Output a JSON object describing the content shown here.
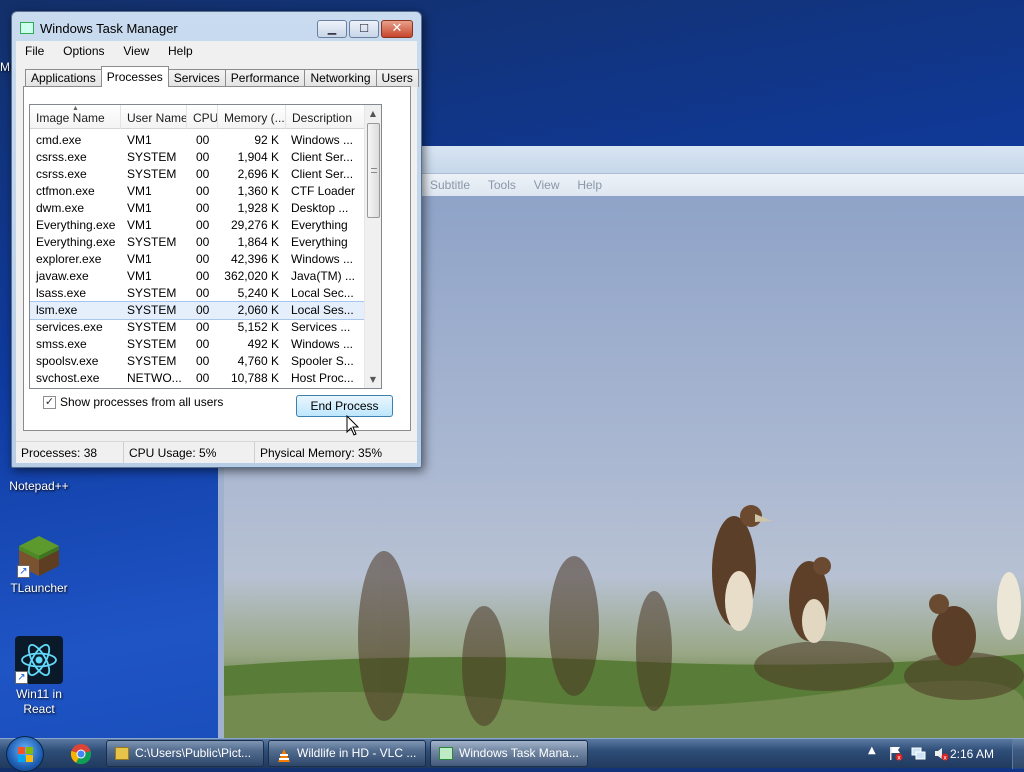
{
  "desktop": {
    "icons": [
      {
        "label": "Notepad++"
      },
      {
        "label": "TLauncher"
      },
      {
        "label": "Win11 in React"
      }
    ],
    "partial_icon_label": "M"
  },
  "vlc_window": {
    "menu": [
      "Subtitle",
      "Tools",
      "View",
      "Help"
    ]
  },
  "task_manager": {
    "title": "Windows Task Manager",
    "menu": [
      "File",
      "Options",
      "View",
      "Help"
    ],
    "tabs": [
      "Applications",
      "Processes",
      "Services",
      "Performance",
      "Networking",
      "Users"
    ],
    "active_tab": "Processes",
    "columns": [
      "Image Name",
      "User Name",
      "CPU",
      "Memory (...",
      "Description"
    ],
    "processes": [
      {
        "name": "cmd.exe",
        "user": "VM1",
        "cpu": "00",
        "mem": "92 K",
        "desc": "Windows ..."
      },
      {
        "name": "csrss.exe",
        "user": "SYSTEM",
        "cpu": "00",
        "mem": "1,904 K",
        "desc": "Client Ser..."
      },
      {
        "name": "csrss.exe",
        "user": "SYSTEM",
        "cpu": "00",
        "mem": "2,696 K",
        "desc": "Client Ser..."
      },
      {
        "name": "ctfmon.exe",
        "user": "VM1",
        "cpu": "00",
        "mem": "1,360 K",
        "desc": "CTF Loader"
      },
      {
        "name": "dwm.exe",
        "user": "VM1",
        "cpu": "00",
        "mem": "1,928 K",
        "desc": "Desktop ..."
      },
      {
        "name": "Everything.exe",
        "user": "VM1",
        "cpu": "00",
        "mem": "29,276 K",
        "desc": "Everything"
      },
      {
        "name": "Everything.exe",
        "user": "SYSTEM",
        "cpu": "00",
        "mem": "1,864 K",
        "desc": "Everything"
      },
      {
        "name": "explorer.exe",
        "user": "VM1",
        "cpu": "00",
        "mem": "42,396 K",
        "desc": "Windows ..."
      },
      {
        "name": "javaw.exe",
        "user": "VM1",
        "cpu": "00",
        "mem": "362,020 K",
        "desc": "Java(TM) ..."
      },
      {
        "name": "lsass.exe",
        "user": "SYSTEM",
        "cpu": "00",
        "mem": "5,240 K",
        "desc": "Local Sec..."
      },
      {
        "name": "lsm.exe",
        "user": "SYSTEM",
        "cpu": "00",
        "mem": "2,060 K",
        "desc": "Local Ses...",
        "selected": true
      },
      {
        "name": "services.exe",
        "user": "SYSTEM",
        "cpu": "00",
        "mem": "5,152 K",
        "desc": "Services ..."
      },
      {
        "name": "smss.exe",
        "user": "SYSTEM",
        "cpu": "00",
        "mem": "492 K",
        "desc": "Windows ..."
      },
      {
        "name": "spoolsv.exe",
        "user": "SYSTEM",
        "cpu": "00",
        "mem": "4,760 K",
        "desc": "Spooler S..."
      },
      {
        "name": "svchost.exe",
        "user": "NETWO...",
        "cpu": "00",
        "mem": "10,788 K",
        "desc": "Host Proc..."
      }
    ],
    "show_all_label": "Show processes from all users",
    "show_all_checked": true,
    "end_process_label": "End Process",
    "status": {
      "processes": "Processes: 38",
      "cpu": "CPU Usage: 5%",
      "memory": "Physical Memory: 35%"
    }
  },
  "taskbar": {
    "buttons": [
      {
        "label": "C:\\Users\\Public\\Pict...",
        "icon": "folder-icon"
      },
      {
        "label": "Wildlife in HD - VLC ...",
        "icon": "vlc-icon"
      },
      {
        "label": "Windows Task Mana...",
        "icon": "task-manager-icon",
        "active": true
      }
    ],
    "clock": "2:16 AM"
  },
  "colors": {
    "selection": "#e5effb",
    "accent_blue": "#3c7fb1",
    "close_red": "#c7452c"
  }
}
